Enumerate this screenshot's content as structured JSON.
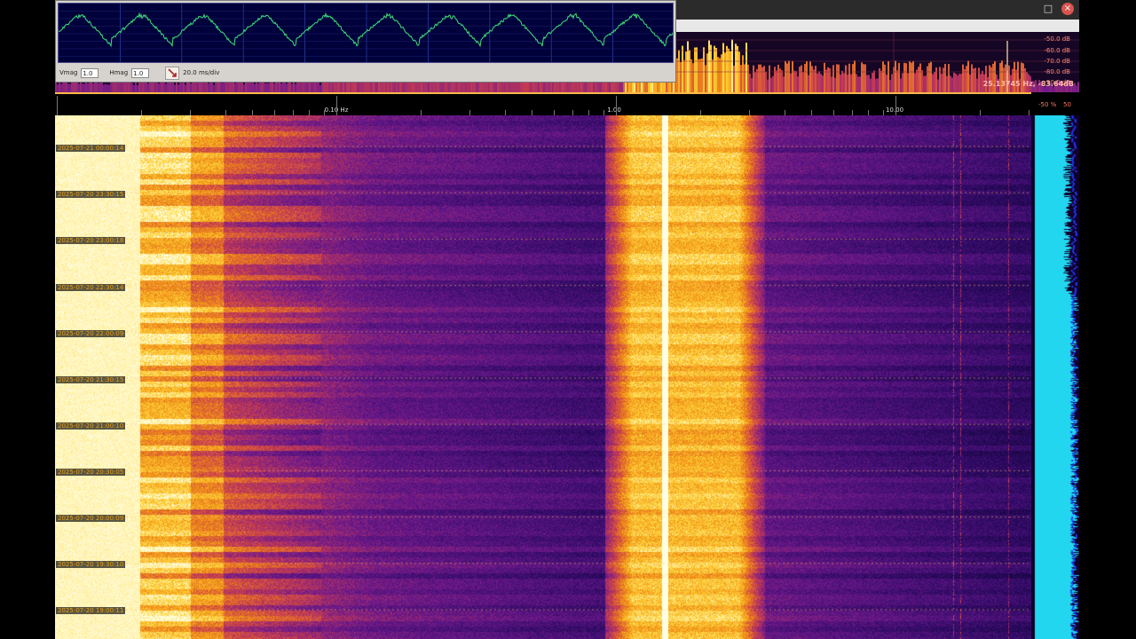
{
  "window": {
    "maximize_glyph": "□",
    "close_glyph": "×"
  },
  "scope": {
    "vmag_label": "Vmag",
    "vmag_value": "1.0",
    "hmag_label": "Hmag",
    "hmag_value": "1.0",
    "timebase": "20.0 ms/div",
    "trace_color": "#3fe07a"
  },
  "spectrum": {
    "db_scale": [
      "-50.0 dB",
      "-60.0 dB",
      "-70.0 dB",
      "-80.0 dB",
      "-90.0 dB"
    ],
    "cursor_readout": "25.13745 Hz, -83.64dB"
  },
  "freq_axis": {
    "labels": [
      "0.10 Hz",
      "1.00",
      "10.00"
    ],
    "percent_labels": [
      "-50 %",
      "50"
    ]
  },
  "waterfall": {
    "timestamps": [
      "2025-07-21 00:00:14",
      "2025-07-20 23:30:15",
      "2025-07-20 23:00:18",
      "2025-07-20 22:30:14",
      "2025-07-20 22:00:09",
      "2025-07-20 21:30:15",
      "2025-07-20 21:00:10",
      "2025-07-20 20:30:05",
      "2025-07-20 20:00:09",
      "2025-07-20 19:30:10",
      "2025-07-20 19:00:11"
    ],
    "level_color": "#23d6f0"
  }
}
